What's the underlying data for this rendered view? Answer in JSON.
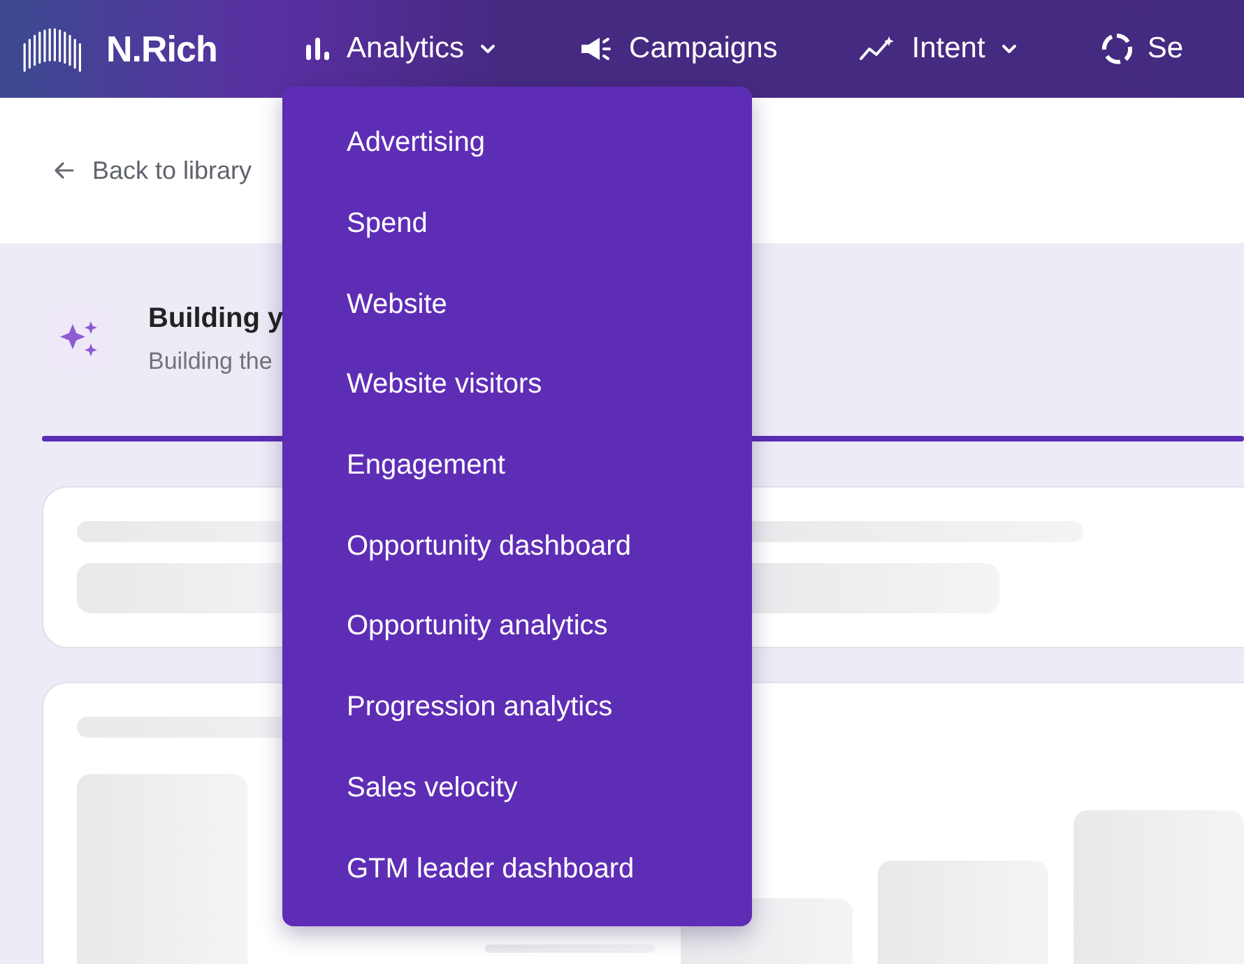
{
  "brand": {
    "name": "N.Rich"
  },
  "nav": [
    {
      "label": "Analytics",
      "kind": "bars",
      "caret": true
    },
    {
      "label": "Campaigns",
      "kind": "megaphone",
      "caret": false
    },
    {
      "label": "Intent",
      "kind": "trend",
      "caret": true
    },
    {
      "label": "Se",
      "kind": "ring",
      "caret": false
    }
  ],
  "back_link": {
    "label": "Back to library"
  },
  "banner": {
    "title": "Building y",
    "subtitle": "Building the"
  },
  "dropdown_menu": [
    "Advertising",
    "Spend",
    "Website",
    "Website visitors",
    "Engagement",
    "Opportunity dashboard",
    "Opportunity analytics",
    "Progression analytics",
    "Sales velocity",
    "GTM leader dashboard"
  ]
}
